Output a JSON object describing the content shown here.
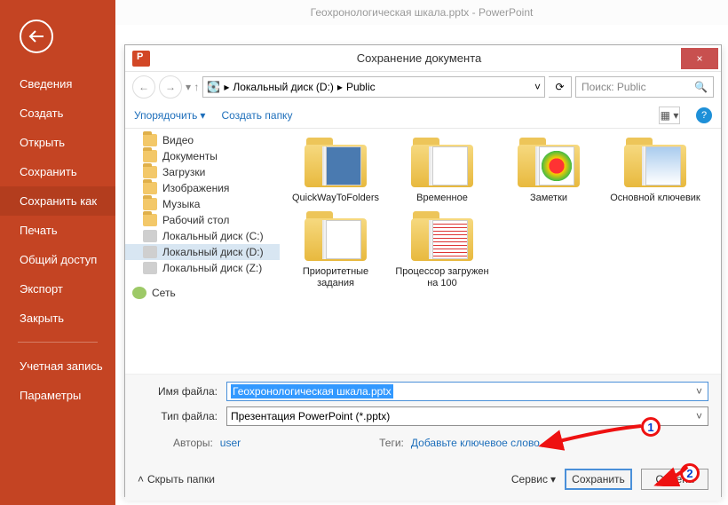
{
  "topbar": {
    "title": "Геохронологическая шкала.pptx - PowerPoint"
  },
  "sidebar": {
    "items": [
      "Сведения",
      "Создать",
      "Открыть",
      "Сохранить",
      "Сохранить как",
      "Печать",
      "Общий доступ",
      "Экспорт",
      "Закрыть"
    ],
    "items2": [
      "Учетная запись",
      "Параметры"
    ]
  },
  "dialog": {
    "title": "Сохранение документа",
    "close": "×",
    "path": {
      "drive": "Локальный диск (D:)",
      "folder": "Public"
    },
    "search_placeholder": "Поиск: Public",
    "toolbar": {
      "organize": "Упорядочить",
      "newfolder": "Создать папку"
    },
    "tree": [
      {
        "t": "f",
        "label": "Видео"
      },
      {
        "t": "f",
        "label": "Документы"
      },
      {
        "t": "f",
        "label": "Загрузки"
      },
      {
        "t": "f",
        "label": "Изображения"
      },
      {
        "t": "f",
        "label": "Музыка"
      },
      {
        "t": "f",
        "label": "Рабочий стол"
      },
      {
        "t": "d",
        "label": "Локальный диск (C:)"
      },
      {
        "t": "d",
        "label": "Локальный диск (D:)",
        "sel": true
      },
      {
        "t": "d",
        "label": "Локальный диск (Z:)"
      },
      {
        "t": "n",
        "label": "Сеть"
      }
    ],
    "files": [
      "QuickWayToFolders",
      "Временное",
      "Заметки",
      "Основной ключевик",
      "Приоритетные задания",
      "Процессор загружен на 100"
    ],
    "form": {
      "filename_label": "Имя файла:",
      "filename_value": "Геохронологическая шкала.pptx",
      "filetype_label": "Тип файла:",
      "filetype_value": "Презентация PowerPoint (*.pptx)",
      "authors_label": "Авторы:",
      "authors_value": "user",
      "tags_label": "Теги:",
      "tags_value": "Добавьте ключевое слово"
    },
    "footer": {
      "hide": "Скрыть папки",
      "service": "Сервис",
      "save": "Сохранить",
      "cancel": "Отмена"
    }
  },
  "annotations": {
    "n1": "1",
    "n2": "2"
  }
}
